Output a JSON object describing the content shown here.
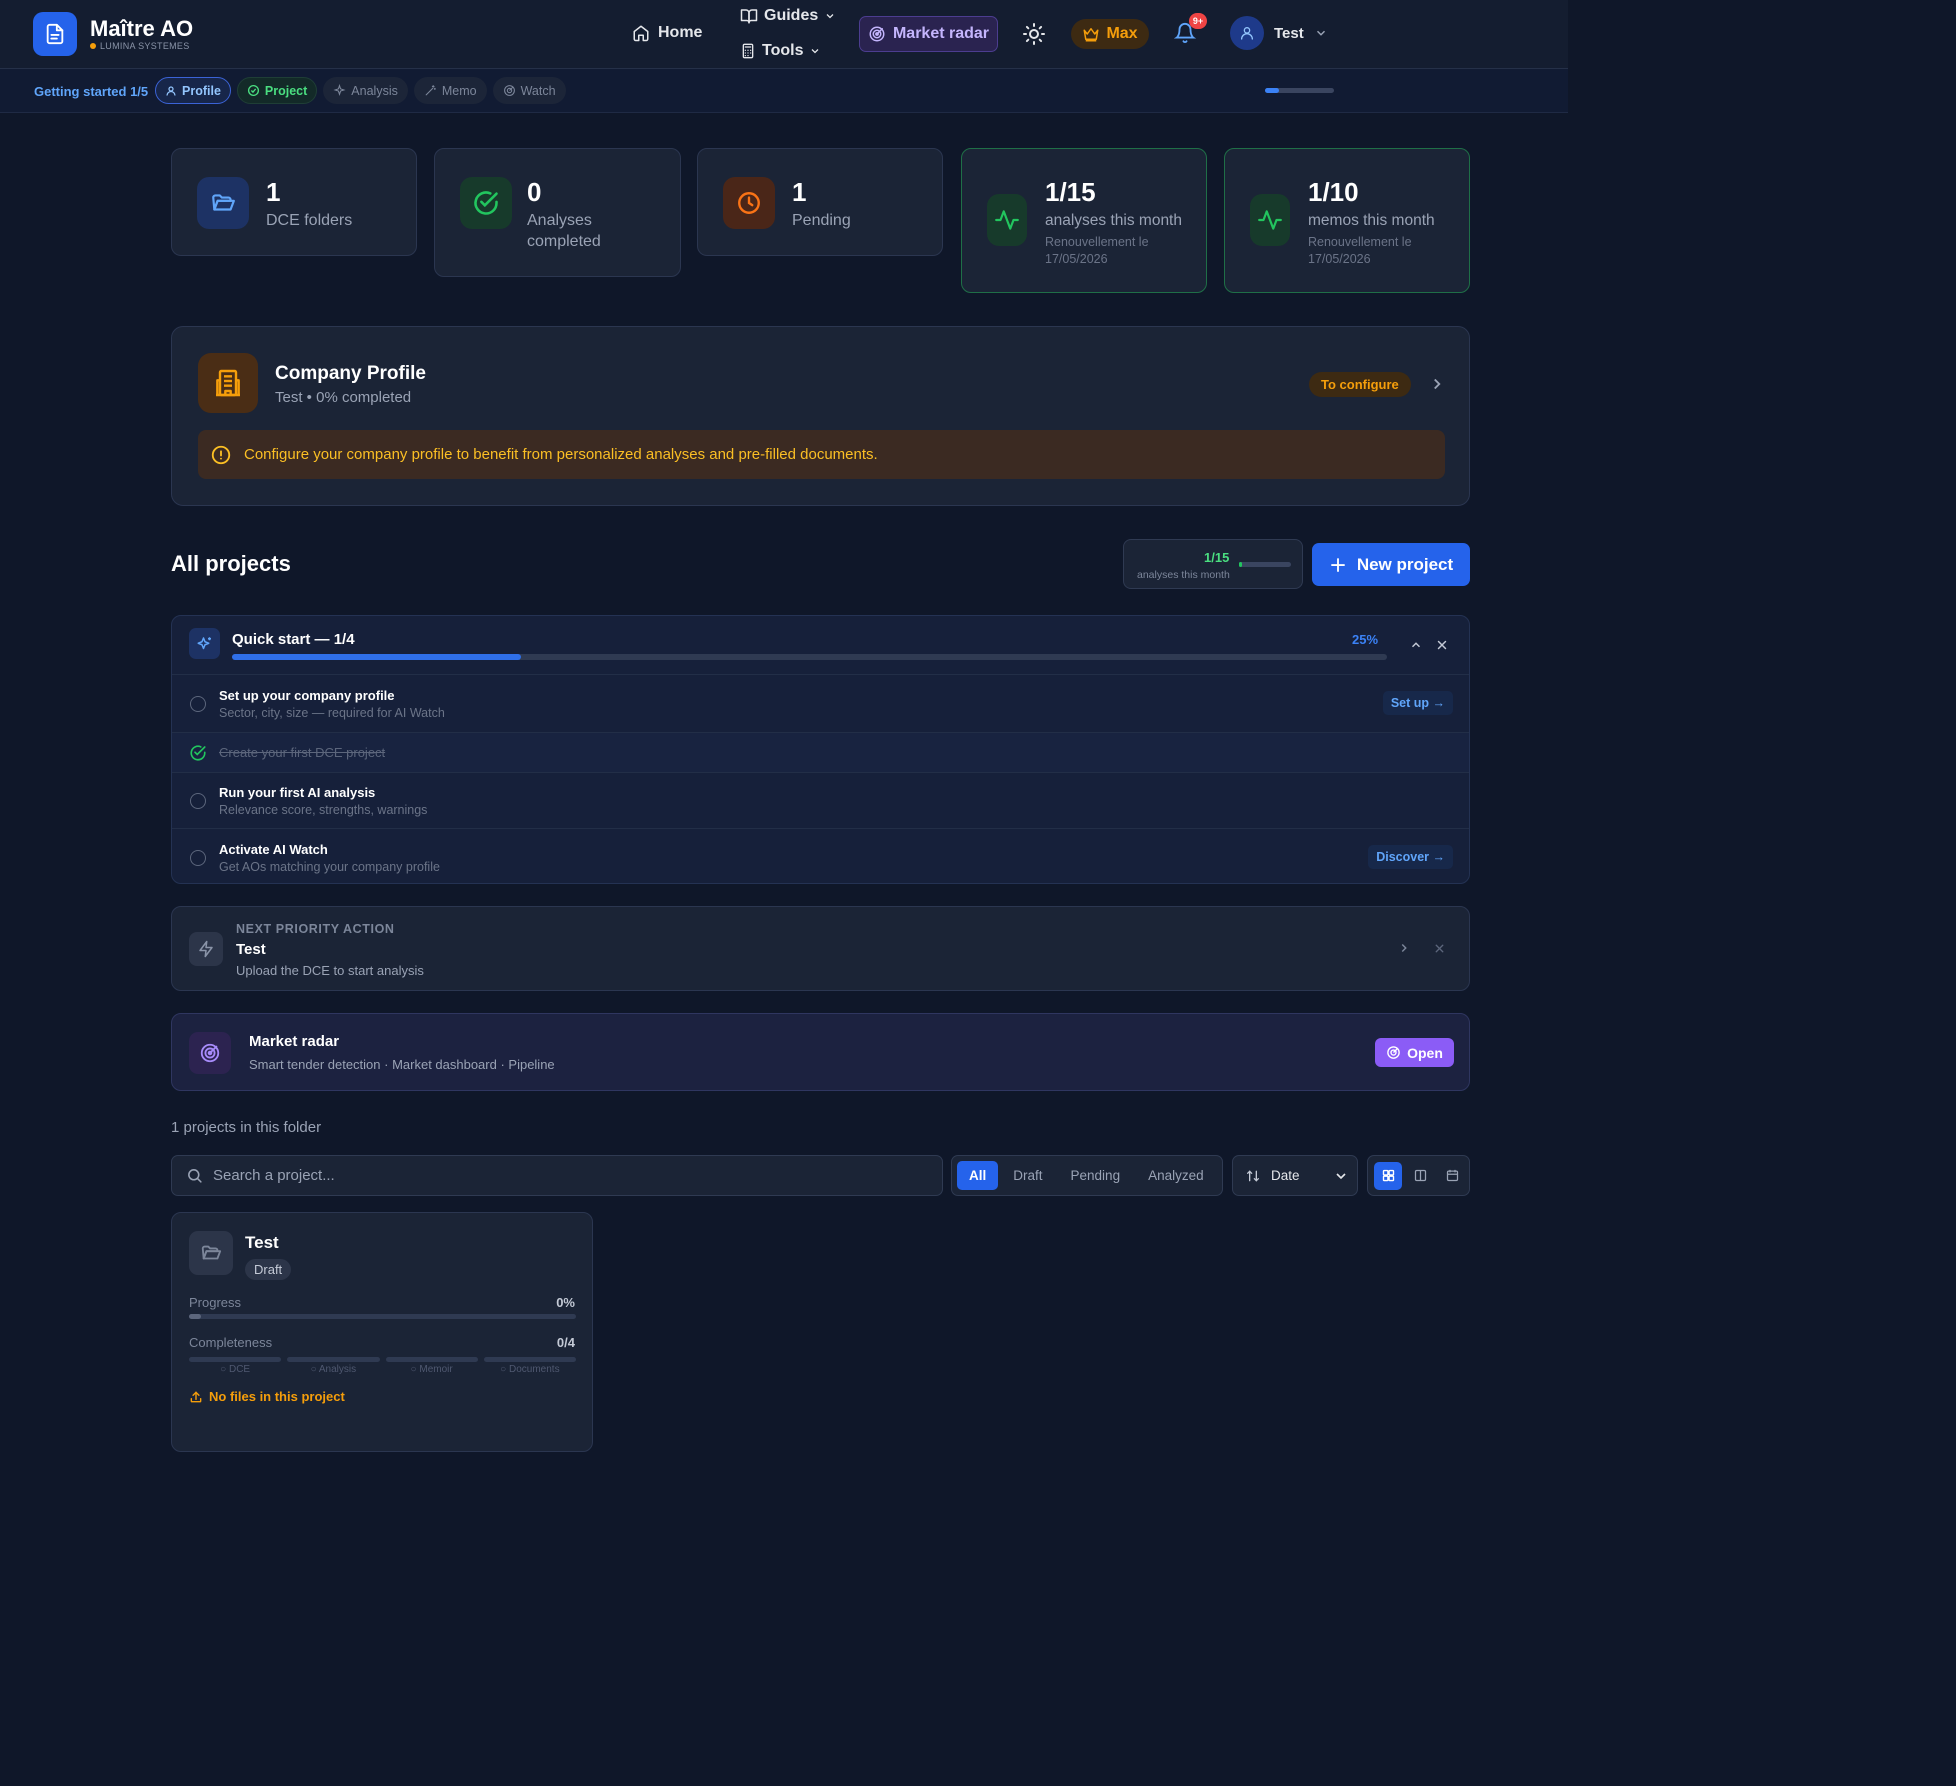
{
  "header": {
    "brand": "Maître AO",
    "brand_sub": "LUMINA SYSTEMES",
    "nav": {
      "home": "Home",
      "guides": "Guides",
      "tools": "Tools"
    },
    "market_radar": "Market radar",
    "plan": "Max",
    "notifications": "9+",
    "user": "Test"
  },
  "onboarding": {
    "label": "Getting started 1/5",
    "steps": [
      "Profile",
      "Project",
      "Analysis",
      "Memo",
      "Watch"
    ],
    "progress": 0.2
  },
  "stats": [
    {
      "number": "1",
      "label": "DCE folders"
    },
    {
      "number": "0",
      "label": "Analyses completed"
    },
    {
      "number": "1",
      "label": "Pending"
    },
    {
      "number": "1/15",
      "label": "analyses this month",
      "sub": "Renouvellement le 17/05/2026"
    },
    {
      "number": "1/10",
      "label": "memos this month",
      "sub": "Renouvellement le 17/05/2026"
    }
  ],
  "company_profile": {
    "title": "Company Profile",
    "subtitle": "Test • 0% completed",
    "badge": "To configure",
    "alert": "Configure your company profile to benefit from personalized analyses and pre-filled documents."
  },
  "projects": {
    "title": "All projects",
    "quota_num": "1/15",
    "quota_label": "analyses this month",
    "quota_fraction": 0.067,
    "new_button": "New project"
  },
  "quick_start": {
    "title": "Quick start — 1/4",
    "percent": "25%",
    "progress": 0.25,
    "items": [
      {
        "title": "Set up your company profile",
        "subtitle": "Sector, city, size — required for AI Watch",
        "action": "Set up →",
        "done": false
      },
      {
        "title": "Create your first DCE project",
        "subtitle": "",
        "action": "",
        "done": true
      },
      {
        "title": "Run your first AI analysis",
        "subtitle": "Relevance score, strengths, warnings",
        "action": "",
        "done": false
      },
      {
        "title": "Activate AI Watch",
        "subtitle": "Get AOs matching your company profile",
        "action": "Discover →",
        "done": false
      }
    ]
  },
  "next_action": {
    "kicker": "NEXT PRIORITY ACTION",
    "title": "Test",
    "subtitle": "Upload the DCE to start analysis"
  },
  "market_radar_card": {
    "title": "Market radar",
    "subtitle": "Smart tender detection · Market dashboard · Pipeline",
    "button": "Open"
  },
  "list": {
    "count": "1 projects in this folder",
    "search_placeholder": "Search a project...",
    "filters": [
      "All",
      "Draft",
      "Pending",
      "Analyzed"
    ],
    "active_filter": "All",
    "sort": "Date"
  },
  "project_card": {
    "title": "Test",
    "status": "Draft",
    "progress_label": "Progress",
    "progress_value": "0%",
    "completeness_label": "Completeness",
    "completeness_value": "0/4",
    "segments": [
      "DCE",
      "Analysis",
      "Memoir",
      "Documents"
    ],
    "warning": "No files in this project"
  }
}
